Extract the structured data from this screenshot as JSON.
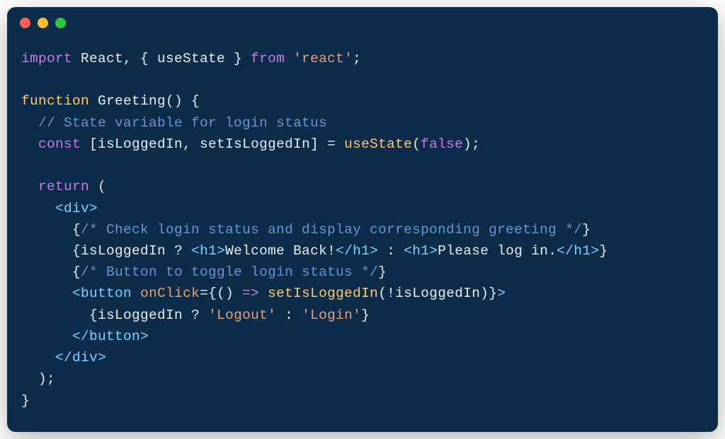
{
  "code": {
    "line1": {
      "import": "import",
      "react": " React, { useState } ",
      "from": "from",
      "space": " ",
      "string": "'react'",
      "semi": ";"
    },
    "line3": {
      "function": "function",
      "name": " Greeting",
      "params": "() {"
    },
    "line4": {
      "indent": "  ",
      "comment": "// State variable for login status"
    },
    "line5": {
      "indent": "  ",
      "const": "const",
      "destructure": " [isLoggedIn, setIsLoggedIn] = ",
      "usestate": "useState",
      "paren_open": "(",
      "false": "false",
      "paren_close": ");"
    },
    "line7": {
      "indent": "  ",
      "return": "return",
      "paren": " ("
    },
    "line8": {
      "indent": "    ",
      "open": "<",
      "div": "div",
      "close": ">"
    },
    "line9": {
      "indent": "      ",
      "brace_open": "{",
      "comment": "/* Check login status and display corresponding greeting */",
      "brace_close": "}"
    },
    "line10": {
      "indent": "      ",
      "brace_open": "{",
      "var": "isLoggedIn ",
      "ternary_q": "? ",
      "h1_open1": "<",
      "h1_1": "h1",
      "h1_close1": ">",
      "text1": "Welcome Back!",
      "h1_open2": "</",
      "h1_2": "h1",
      "h1_close2": ">",
      "colon": " : ",
      "h1_open3": "<",
      "h1_3": "h1",
      "h1_close3": ">",
      "text2": "Please log in.",
      "h1_open4": "</",
      "h1_4": "h1",
      "h1_close4": ">",
      "brace_close": "}"
    },
    "line11": {
      "indent": "      ",
      "brace_open": "{",
      "comment": "/* Button to toggle login status */",
      "brace_close": "}"
    },
    "line12": {
      "indent": "      ",
      "open": "<",
      "button": "button",
      "space": " ",
      "onclick": "onClick",
      "equals": "=",
      "brace_open": "{",
      "arrow_params": "() ",
      "arrow": "=>",
      "space2": " ",
      "setfn": "setIsLoggedIn",
      "paren_open": "(",
      "bang": "!",
      "var": "isLoggedIn",
      "paren_close": ")",
      "brace_close": "}",
      "close": ">"
    },
    "line13": {
      "indent": "        ",
      "brace_open": "{",
      "var": "isLoggedIn ",
      "ternary_q": "? ",
      "str1": "'Logout'",
      "colon": " : ",
      "str2": "'Login'",
      "brace_close": "}"
    },
    "line14": {
      "indent": "      ",
      "open": "</",
      "button": "button",
      "close": ">"
    },
    "line15": {
      "indent": "    ",
      "open": "</",
      "div": "div",
      "close": ">"
    },
    "line16": {
      "indent": "  ",
      "paren": ");"
    },
    "line17": {
      "brace": "}"
    }
  }
}
